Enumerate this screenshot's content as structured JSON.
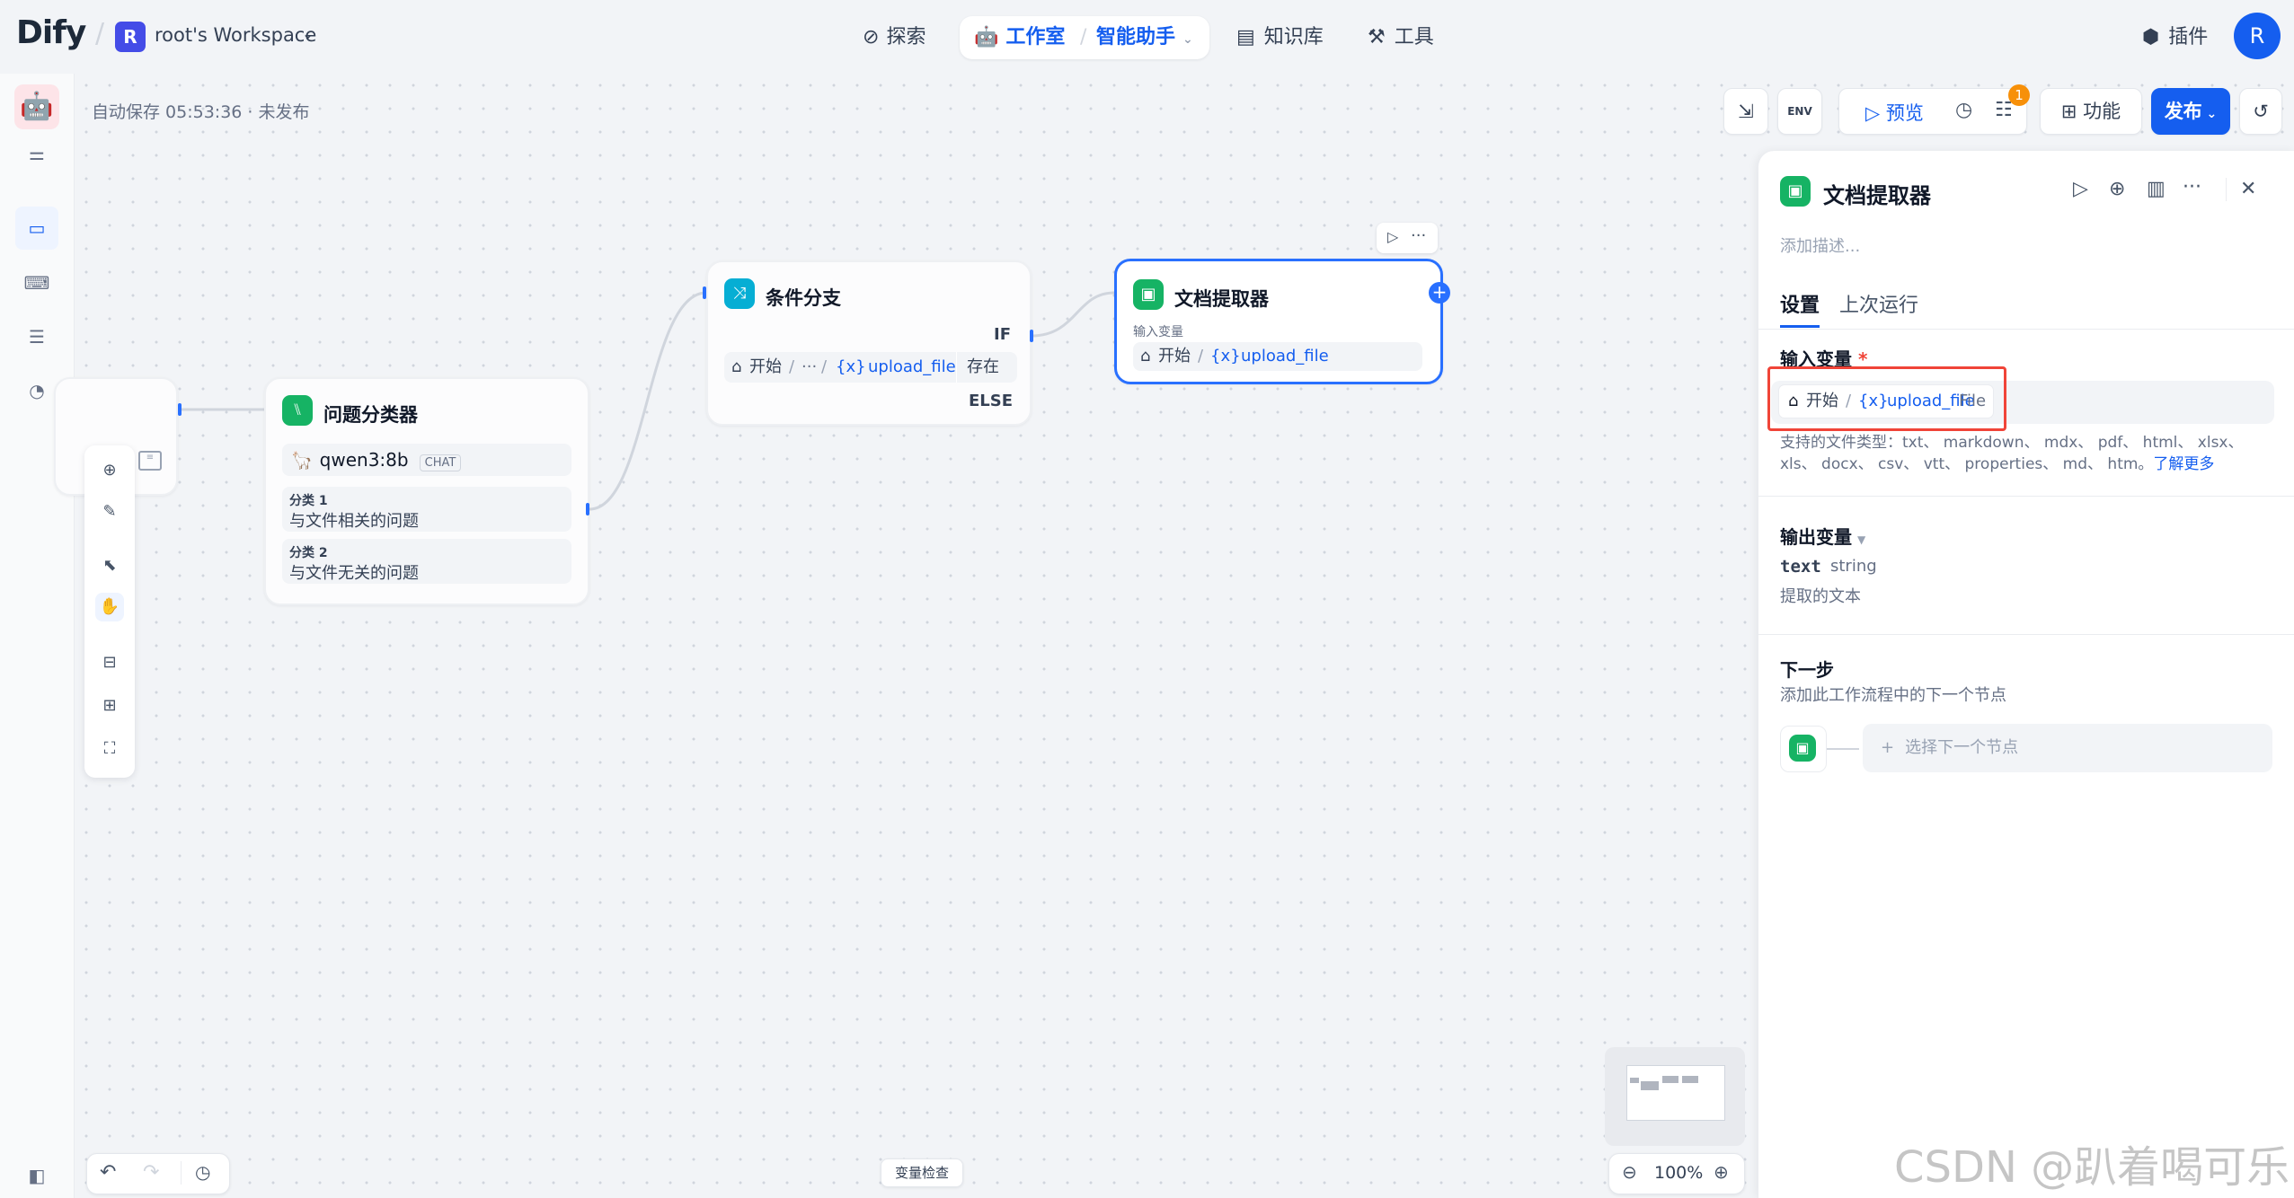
{
  "topbar": {
    "logo": "Dify",
    "workspace_initial": "R",
    "workspace_name": "root's Workspace",
    "nav": {
      "explore": "探索",
      "studio": "工作室",
      "assistant": "智能助手",
      "knowledge": "知识库",
      "tools": "工具"
    },
    "plugins": "插件",
    "user_initial": "R"
  },
  "toolbar": {
    "autosave": "自动保存 05:53:36 · 未发布",
    "preview": "预览",
    "features": "功能",
    "publish": "发布",
    "badge_count": "1",
    "env": "ENV"
  },
  "nodes": {
    "classifier": {
      "title": "问题分类器",
      "model": "qwen3:8b",
      "model_tag": "CHAT",
      "class1_label": "分类 1",
      "class1_text": "与文件相关的问题",
      "class2_label": "分类 2",
      "class2_text": "与文件无关的问题"
    },
    "ifelse": {
      "title": "条件分支",
      "if_label": "IF",
      "else_label": "ELSE",
      "var_prefix": "开始",
      "ellipsis": "···",
      "var_name": "upload_file",
      "operator": "存在"
    },
    "doc": {
      "title": "文档提取器",
      "input_label": "输入变量",
      "var_prefix": "开始",
      "var_name": "upload_file"
    }
  },
  "panel": {
    "title": "文档提取器",
    "desc_placeholder": "添加描述...",
    "tab_settings": "设置",
    "tab_last_run": "上次运行",
    "input_var_label": "输入变量",
    "required_mark": "*",
    "input_var_prefix": "开始",
    "input_var_name": "upload_file",
    "input_var_type": "File",
    "supported_types_line1": "支持的文件类型：txt、 markdown、 mdx、 pdf、 html、 xlsx、",
    "supported_types_line2": "xls、 docx、 csv、 vtt、 properties、 md、 htm。",
    "learn_more": "了解更多",
    "output_var_label": "输出变量",
    "output_name": "text",
    "output_type": "string",
    "output_desc": "提取的文本",
    "next_step_label": "下一步",
    "next_step_desc": "添加此工作流程中的下一个节点",
    "select_next": "选择下一个节点"
  },
  "bottom": {
    "var_inspect": "变量检查",
    "zoom": "100%"
  },
  "watermark": "CSDN @趴着喝可乐",
  "colors": {
    "accent": "#155eef",
    "classifier_icon": "#16b364",
    "ifelse_icon": "#06aed4",
    "doc_icon": "#16b364",
    "highlight_box": "#f04438"
  }
}
